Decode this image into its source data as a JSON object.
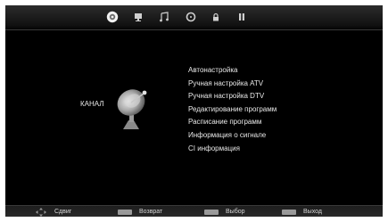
{
  "tabs": [
    {
      "icon": "channel-dish-icon",
      "active": true
    },
    {
      "icon": "picture-monitor-icon",
      "active": false
    },
    {
      "icon": "sound-note-icon",
      "active": false
    },
    {
      "icon": "time-clock-icon",
      "active": false
    },
    {
      "icon": "lock-icon",
      "active": false
    },
    {
      "icon": "setup-icon",
      "active": false
    }
  ],
  "section": {
    "label": "КАНАЛ",
    "icon": "satellite-dish-icon"
  },
  "menu": {
    "items": [
      "Автонастройка",
      "Ручная настройка ATV",
      "Ручная настройка DTV",
      "Редактирование программ",
      "Расписание программ",
      "Информация о сигнале",
      "CI информация"
    ]
  },
  "footer": {
    "move": "Сдвиг",
    "back": "Возврат",
    "select": "Выбор",
    "exit": "Выход"
  },
  "colors": {
    "background": "#000000",
    "text": "#e8e8e8",
    "footer_key": "#9a9a9a"
  }
}
